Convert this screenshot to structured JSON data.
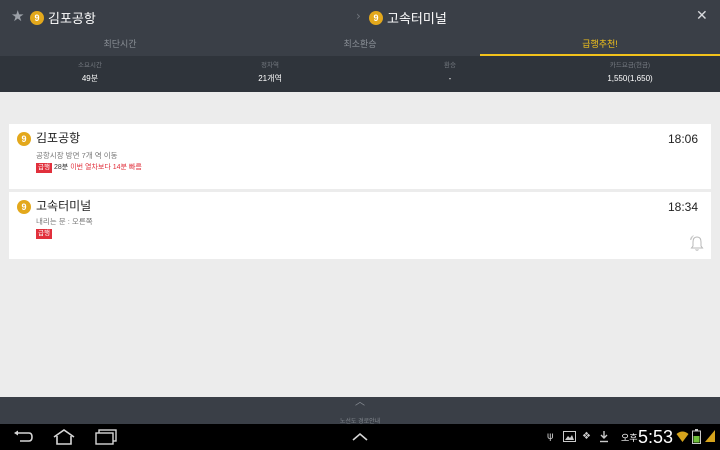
{
  "header": {
    "from_line": "9",
    "from_station": "김포공항",
    "to_line": "9",
    "to_station": "고속터미널",
    "arrow": "›",
    "star_icon": "star-icon",
    "close_icon": "close-icon"
  },
  "tabs": [
    {
      "label": "최단시간",
      "active": false
    },
    {
      "label": "최소환승",
      "active": false
    },
    {
      "label": "급행추천!",
      "active": true
    }
  ],
  "summary": [
    {
      "label": "소요시간",
      "value": "49분"
    },
    {
      "label": "정차역",
      "value": "21개역"
    },
    {
      "label": "환승",
      "value": "-"
    },
    {
      "label": "카드요금(현금)",
      "value": "1,550(1,650)"
    }
  ],
  "route": [
    {
      "line": "9",
      "station": "김포공항",
      "time": "18:06",
      "sub": "공항시장 방면 7개 역 이동",
      "tag": "급행",
      "duration": "28분",
      "note": "이번 열차보다 14분 빠름"
    },
    {
      "line": "9",
      "station": "고속터미널",
      "time": "18:34",
      "sub": "내리는 문 : 오른쪽",
      "tag": "급행"
    }
  ],
  "bottom": {
    "label": "노선도 경로안내"
  },
  "system": {
    "ampm": "오후",
    "clock": "5:53"
  },
  "colors": {
    "line9": "#e3a81c",
    "accent": "#f2c21b",
    "express": "#e1303c",
    "header": "#3a3f47"
  }
}
